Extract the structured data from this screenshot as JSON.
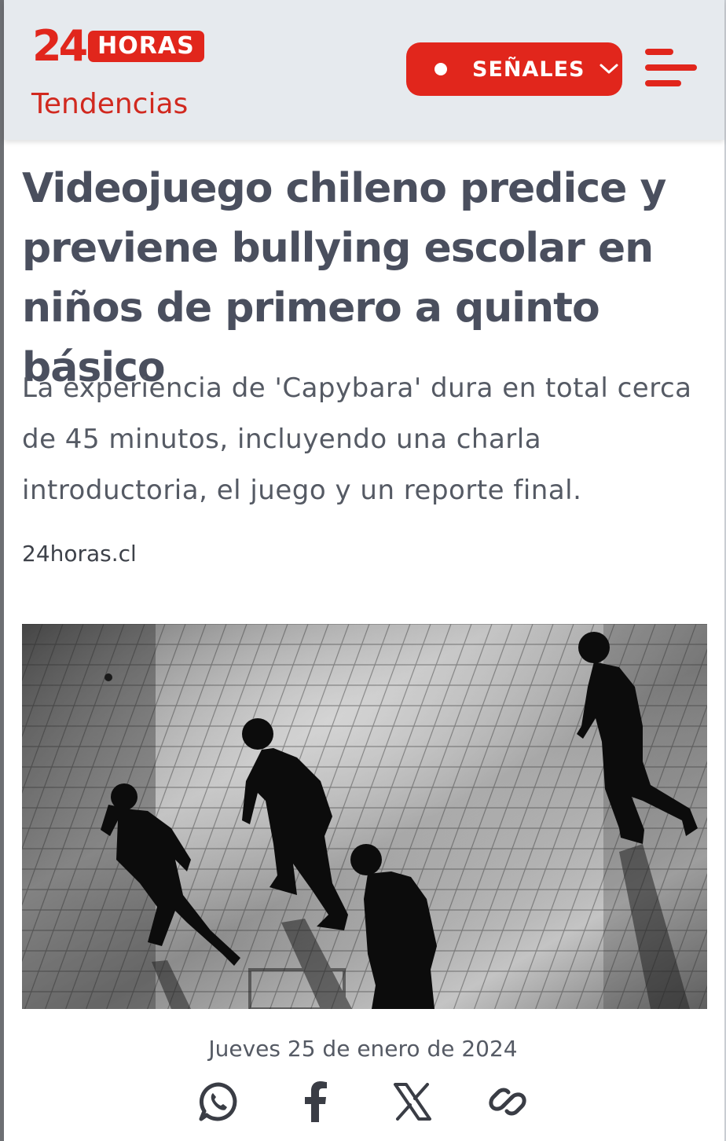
{
  "header": {
    "logo": {
      "number": "24",
      "word": "HORAS"
    },
    "section": "Tendencias",
    "signals_button": {
      "label": "SEÑALES"
    },
    "menu": {
      "icon": "hamburger-menu-icon"
    },
    "colors": {
      "brand": "#e1261c",
      "background": "#e6eaee"
    }
  },
  "article": {
    "headline": "Videojuego chileno predice y previene bullying escolar en niños de primero a quinto básico",
    "subtitle": "La experiencia de 'Capybara' dura en total cerca de 45 minutos, incluyendo una charla introductoria, el juego y un reporte final.",
    "source": "24horas.cl",
    "date": "Jueves 25 de enero de 2024"
  },
  "share": [
    {
      "icon": "whatsapp-icon"
    },
    {
      "icon": "facebook-icon"
    },
    {
      "icon": "x-twitter-icon"
    },
    {
      "icon": "link-icon"
    }
  ]
}
